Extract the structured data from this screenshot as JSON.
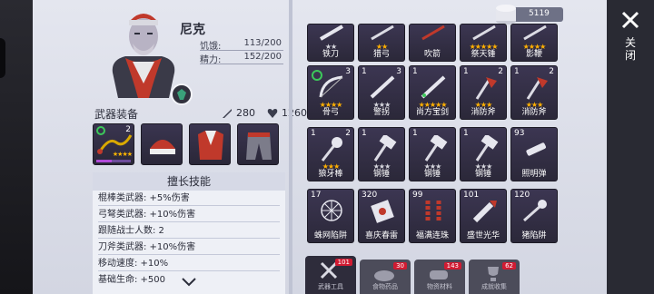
{
  "character": {
    "name": "尼克",
    "hunger_label": "饥饿:",
    "hunger_value": "113/200",
    "energy_label": "精力:",
    "energy_value": "152/200"
  },
  "equipment": {
    "title": "武器装备",
    "attack": "280",
    "health": "1260",
    "slot1_count": "2"
  },
  "skills": {
    "title": "擅长技能",
    "items": [
      "棍棒类武器: +5%伤害",
      "弓弩类武器: +10%伤害",
      "跟随战士人数: 2",
      "刀斧类武器: +10%伤害",
      "移动速度: +10%",
      "基础生命: +500"
    ]
  },
  "coins": "5119",
  "grid_top": [
    {
      "label": "铁刀",
      "stars": "★★",
      "grey": true
    },
    {
      "label": "猎弓",
      "stars": "★★"
    },
    {
      "label": "吹箭",
      "stars": ""
    },
    {
      "label": "祭天锤",
      "stars": "★★★★★"
    },
    {
      "label": "影鞭",
      "stars": "★★★★"
    }
  ],
  "grid_row2": [
    {
      "count": "",
      "corner": "3",
      "label": "骨弓",
      "stars": "★★★★"
    },
    {
      "count": "1",
      "corner": "3",
      "label": "警拐",
      "stars": "★★★",
      "grey": true
    },
    {
      "count": "1",
      "corner": "",
      "label": "尚方宝剑",
      "stars": "★★★★★"
    },
    {
      "count": "1",
      "corner": "2",
      "label": "消防斧",
      "stars": "★★★"
    },
    {
      "count": "1",
      "corner": "2",
      "label": "消防斧",
      "stars": "★★★"
    }
  ],
  "grid_row3": [
    {
      "count": "1",
      "corner": "2",
      "label": "狼牙棒",
      "stars": "★★★"
    },
    {
      "count": "1",
      "corner": "",
      "label": "钢锤",
      "stars": "★★★",
      "grey": true
    },
    {
      "count": "1",
      "corner": "",
      "label": "钢锤",
      "stars": "★★★",
      "grey": true
    },
    {
      "count": "1",
      "corner": "",
      "label": "钢锤",
      "stars": "★★★",
      "grey": true
    },
    {
      "count": "93",
      "corner": "",
      "label": "照明弹",
      "stars": ""
    }
  ],
  "grid_row4": [
    {
      "count": "17",
      "label": "蛛网陷阱"
    },
    {
      "count": "320",
      "label": "喜庆春雷"
    },
    {
      "count": "99",
      "label": "福满连珠"
    },
    {
      "count": "101",
      "label": "盛世光华"
    },
    {
      "count": "120",
      "label": "猪陷阱"
    }
  ],
  "tabs": [
    {
      "label": "武器工具",
      "badge": "101"
    },
    {
      "label": "食物药品",
      "badge": "30"
    },
    {
      "label": "物资材料",
      "badge": "143"
    },
    {
      "label": "成就收集",
      "badge": "62"
    }
  ],
  "close_label": "关闭"
}
